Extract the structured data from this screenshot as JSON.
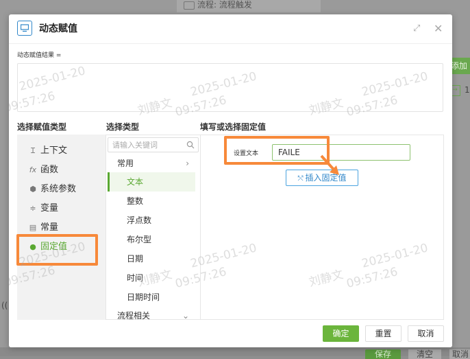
{
  "background": {
    "top_title": "流程: 流程触发",
    "add_button": "添加",
    "right_number": "1",
    "left_paren": "((",
    "save_button": "保存",
    "clear_button": "清空",
    "cancel_button": "取消"
  },
  "dialog": {
    "title": "动态赋值",
    "result_label": "动态赋值结果 =",
    "result_value": ""
  },
  "columns": {
    "assign_type": "选择赋值类型",
    "select_type": "选择类型",
    "fill_value": "填写或选择固定值"
  },
  "assign_types": [
    {
      "label": "上下文",
      "icon": "cursor-icon"
    },
    {
      "label": "函数",
      "icon": "function-icon"
    },
    {
      "label": "系统参数",
      "icon": "gear-icon"
    },
    {
      "label": "变量",
      "icon": "variable-icon"
    },
    {
      "label": "常量",
      "icon": "constant-icon"
    },
    {
      "label": "固定值",
      "icon": "dot-icon",
      "active": true
    }
  ],
  "select_type": {
    "search_placeholder": "请输入关键词",
    "category_common": "常用",
    "sub_items": [
      "文本",
      "整数",
      "浮点数",
      "布尔型",
      "日期",
      "时间",
      "日期时间"
    ],
    "active_sub": "文本",
    "category_process": "流程相关"
  },
  "fixed_value": {
    "field_label": "设置文本",
    "field_value": "FAILE",
    "insert_button": "插入固定值"
  },
  "footer": {
    "ok": "确定",
    "reset": "重置",
    "cancel": "取消"
  },
  "watermark": {
    "date": "2025-01-20",
    "time": "09:57:26",
    "name": "刘静文"
  },
  "colors": {
    "accent_green": "#6bb53c",
    "highlight_orange": "#f7893a",
    "link_blue": "#2f86c9"
  }
}
